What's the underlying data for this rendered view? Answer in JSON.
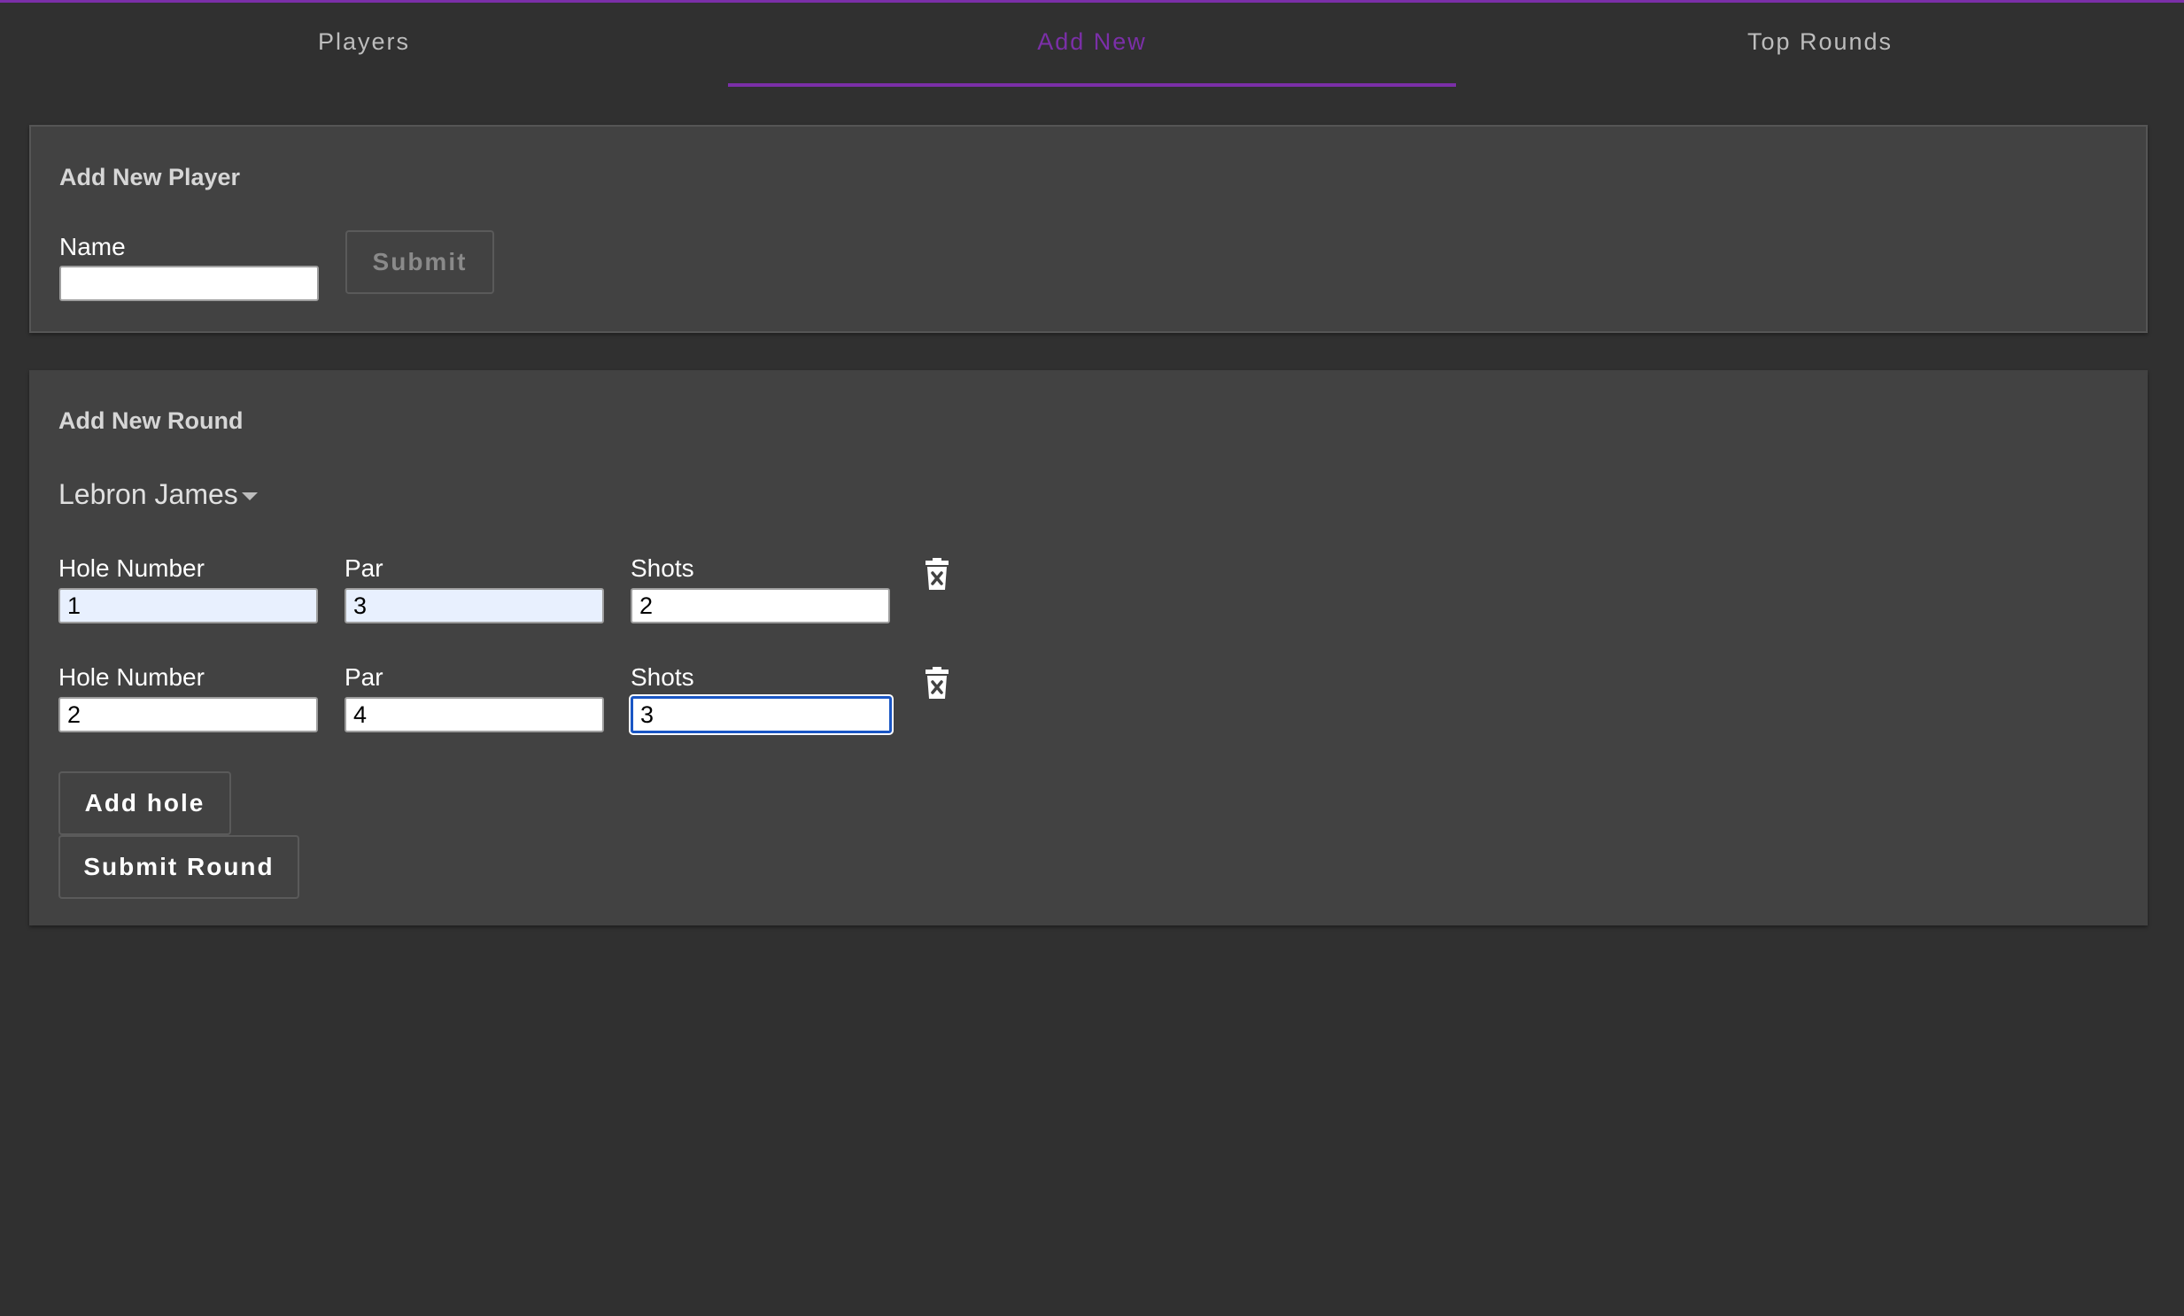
{
  "tabs": [
    {
      "label": "Players",
      "active": false
    },
    {
      "label": "Add New",
      "active": true
    },
    {
      "label": "Top Rounds",
      "active": false
    }
  ],
  "colors": {
    "accent": "#7b2fa8",
    "background": "#303030",
    "card": "#424242",
    "focus": "#1a56c4",
    "autofill": "#e8f0fe"
  },
  "add_player": {
    "title": "Add New Player",
    "name_label": "Name",
    "name_value": "",
    "submit_label": "Submit"
  },
  "add_round": {
    "title": "Add New Round",
    "player_select": "Lebron James",
    "holes": [
      {
        "hole_label": "Hole Number",
        "hole_value": "1",
        "par_label": "Par",
        "par_value": "3",
        "shots_label": "Shots",
        "shots_value": "2",
        "delete_icon": "trash-x-icon"
      },
      {
        "hole_label": "Hole Number",
        "hole_value": "2",
        "par_label": "Par",
        "par_value": "4",
        "shots_label": "Shots",
        "shots_value": "3",
        "delete_icon": "trash-x-icon"
      }
    ],
    "add_hole_label": "Add hole",
    "submit_round_label": "Submit Round"
  }
}
